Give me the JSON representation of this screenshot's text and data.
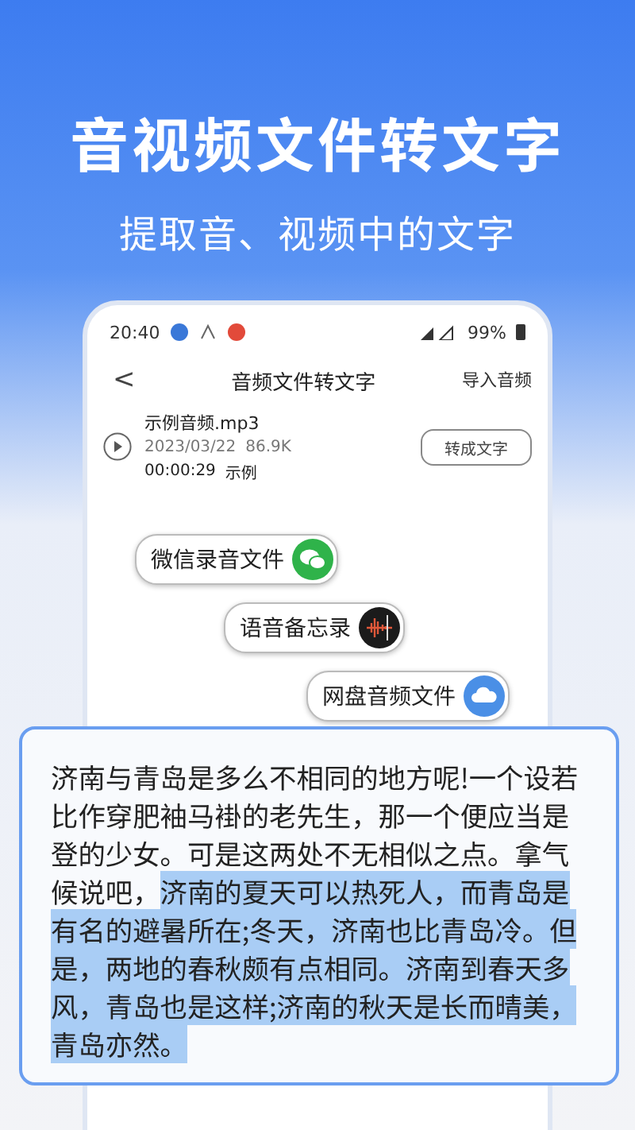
{
  "headline": "音视频文件转文字",
  "subheadline": "提取音、视频中的文字",
  "status_bar": {
    "time": "20:40",
    "battery": "99%"
  },
  "header": {
    "back": "<",
    "title": "音频文件转文字",
    "action": "导入音频"
  },
  "file": {
    "name": "示例音频.mp3",
    "date": "2023/03/22",
    "size": "86.9K",
    "duration": "00:00:29",
    "tag": "示例",
    "button": "转成文字"
  },
  "sources": [
    {
      "label": "微信录音文件",
      "kind": "chat"
    },
    {
      "label": "语音备忘录",
      "kind": "memo"
    },
    {
      "label": "网盘音频文件",
      "kind": "cloud"
    }
  ],
  "transcript": {
    "plain": "济南与青岛是多么不相同的地方呢!一个设若比作穿肥袖马褂的老先生，那一个便应当是登的少女。可是这两处不无相似之点。拿气候说吧，",
    "highlighted": "济南的夏天可以热死人，而青岛是有名的避暑所在;冬天，济南也比青岛冷。但是，两地的春秋颇有点相同。济南到春天多风，青岛也是这样;济南的秋天是长而晴美，青岛亦然。"
  }
}
